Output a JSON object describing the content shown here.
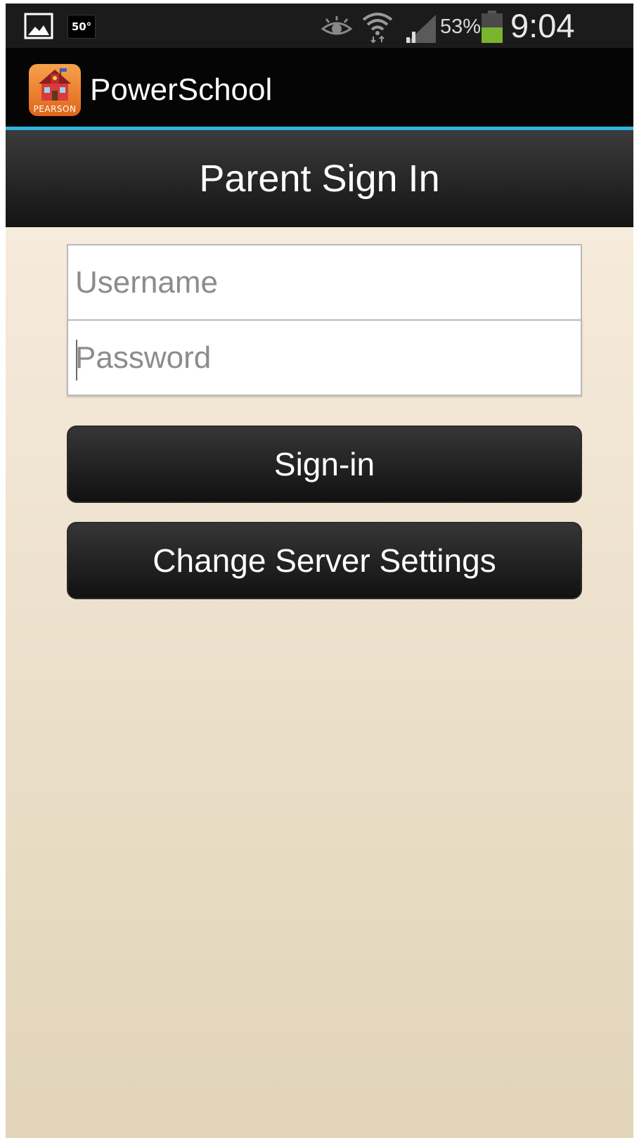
{
  "status_bar": {
    "temperature": "50°",
    "battery_percent": "53%",
    "time": "9:04 PM",
    "battery_color": "#79b62b",
    "icons": [
      "gallery-icon",
      "temperature-icon",
      "eye-icon",
      "wifi-icon",
      "signal-icon",
      "battery-icon"
    ]
  },
  "app_bar": {
    "title": "PowerSchool",
    "icon_caption": "PEARSON",
    "accent_color": "#2fb3e0"
  },
  "page": {
    "title": "Parent Sign In"
  },
  "form": {
    "username_placeholder": "Username",
    "password_placeholder": "Password",
    "signin_label": "Sign-in",
    "server_settings_label": "Change Server Settings"
  }
}
